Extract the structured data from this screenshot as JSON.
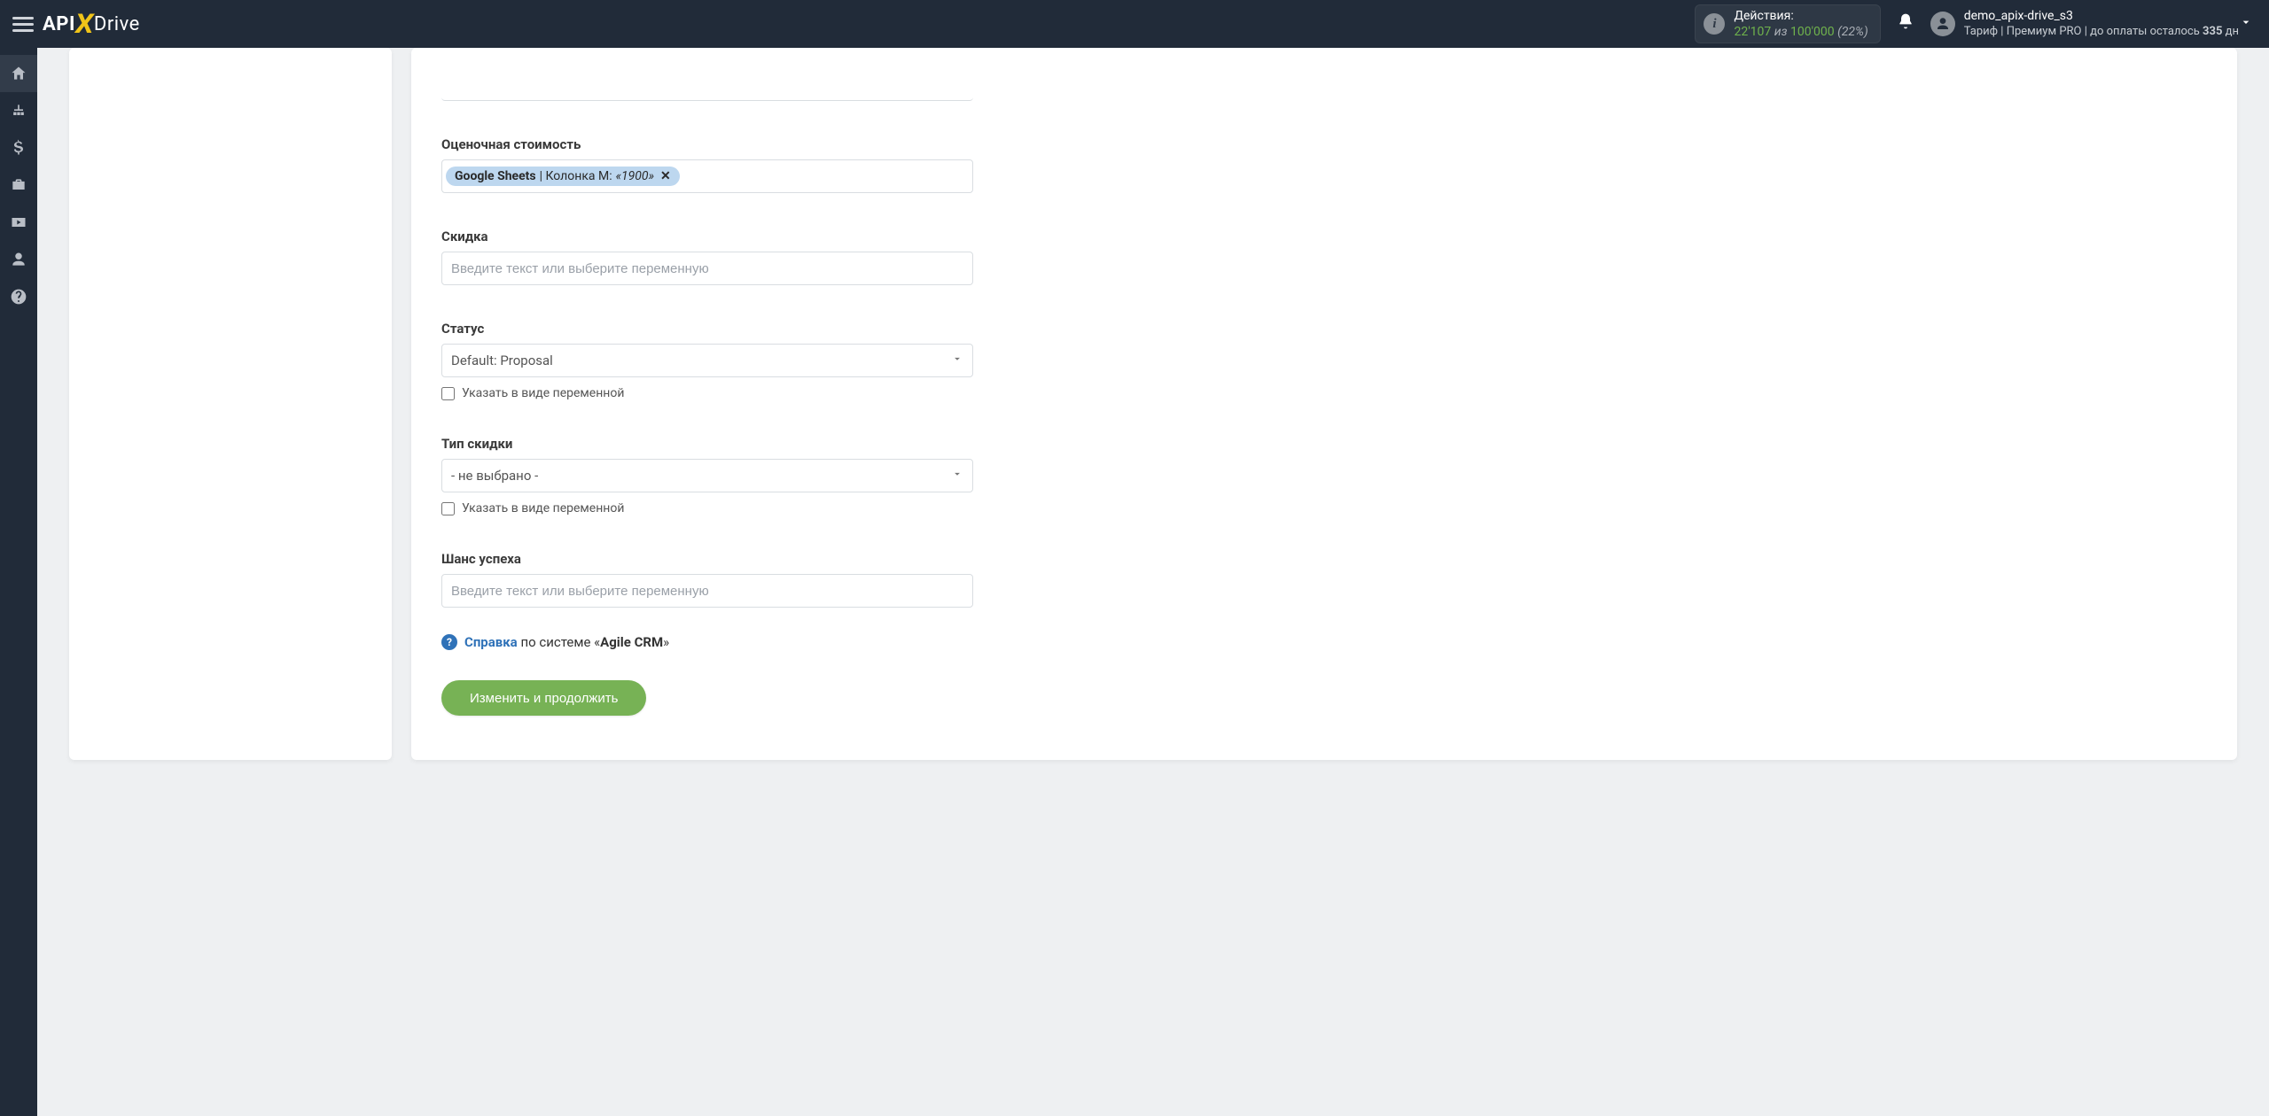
{
  "header": {
    "logo": {
      "api": "API",
      "x": "X",
      "drive": "Drive"
    },
    "actions": {
      "label": "Действия:",
      "count": "22'107",
      "of": "из",
      "limit": "100'000",
      "percent": "(22%)"
    },
    "user": {
      "name": "demo_apix-drive_s3",
      "tariff_label": "Тариф | ",
      "tariff_name": "Премиум PRO",
      "pay_left_prefix": " |  до оплаты осталось ",
      "days": "335",
      "days_suffix": " дн"
    }
  },
  "form": {
    "estimated_cost": {
      "label": "Оценочная стоимость",
      "tag_source": "Google Sheets",
      "tag_sep": " | Колонка M: ",
      "tag_value": "«1900»"
    },
    "discount": {
      "label": "Скидка",
      "placeholder": "Введите текст или выберите переменную"
    },
    "status": {
      "label": "Статус",
      "value": "Default: Proposal",
      "as_variable": "Указать в виде переменной"
    },
    "discount_type": {
      "label": "Тип скидки",
      "value": "- не выбрано -",
      "as_variable": "Указать в виде переменной"
    },
    "success_chance": {
      "label": "Шанс успеха",
      "placeholder": "Введите текст или выберите переменную"
    },
    "help": {
      "link": "Справка",
      "text": " по системе «",
      "system": "Agile CRM",
      "close": "»"
    },
    "submit": "Изменить и продолжить"
  }
}
